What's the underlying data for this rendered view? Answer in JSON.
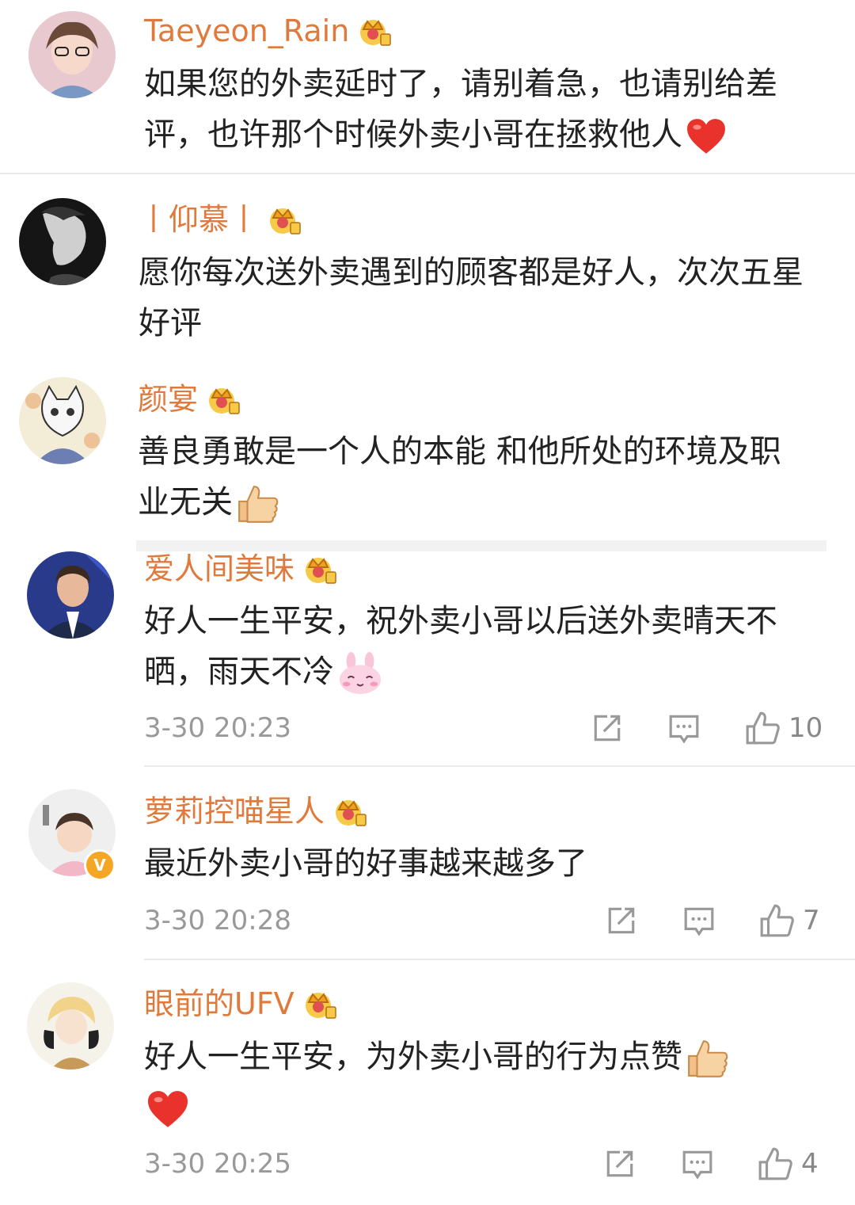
{
  "comments": [
    {
      "username": "Taeyeon_Rain",
      "text": "如果您的外卖延时了，请别着急，也请别给差评，也许那个时候外卖小哥在拯救他人",
      "trailing_emoji": "heart"
    },
    {
      "username": "丨仰慕丨",
      "text": "愿你每次送外卖遇到的顾客都是好人，次次五星好评",
      "trailing_emoji": ""
    },
    {
      "username": "颜宴",
      "text": "善良勇敢是一个人的本能 和他所处的环境及职业无关",
      "trailing_emoji": "thumbs-up"
    },
    {
      "username": "爱人间美味",
      "text": "好人一生平安，祝外卖小哥以后送外卖晴天不晒，雨天不冷",
      "trailing_emoji": "bunny",
      "timestamp": "3-30 20:23",
      "likes": "10"
    },
    {
      "username": "萝莉控喵星人",
      "text": "最近外卖小哥的好事越来越多了",
      "trailing_emoji": "",
      "timestamp": "3-30 20:28",
      "likes": "7",
      "verified": true
    },
    {
      "username": "眼前的UFV",
      "text": "好人一生平安，为外卖小哥的行为点赞",
      "trailing_emoji": "thumbs-up-heart",
      "timestamp": "3-30 20:25",
      "likes": "4"
    }
  ],
  "colors": {
    "username": "#e07a3c",
    "body_text": "#222222",
    "meta_text": "#999999",
    "divider": "#e9e9e9"
  },
  "icons": {
    "member_badge": "crown-icon",
    "share": "share-icon",
    "reply": "comment-icon",
    "like": "thumbs-up-icon",
    "verified": "verified-badge-icon"
  }
}
